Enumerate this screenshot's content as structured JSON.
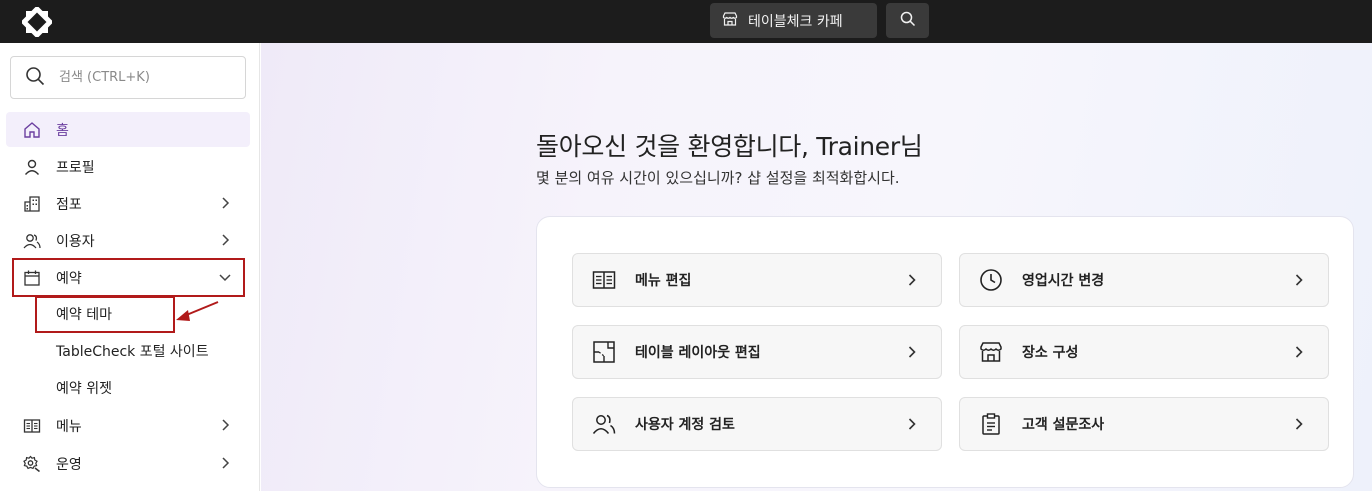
{
  "topbar": {
    "logo_icon": "tablecheck-logo-icon",
    "store_name": "테이블체크 카페",
    "store_icon": "storefront-icon",
    "search_icon": "search-icon"
  },
  "sidebar": {
    "search": {
      "placeholder": "검색 (CTRL+K)"
    },
    "items": [
      {
        "label": "홈",
        "icon": "home-icon",
        "active": true
      },
      {
        "label": "프로필",
        "icon": "person-icon"
      },
      {
        "label": "점포",
        "icon": "building-icon",
        "has_submenu": true
      },
      {
        "label": "이용자",
        "icon": "users-icon",
        "has_submenu": true
      },
      {
        "label": "예약",
        "icon": "calendar-icon",
        "expanded": true
      },
      {
        "label": "메뉴",
        "icon": "menu-book-icon",
        "has_submenu": true
      },
      {
        "label": "운영",
        "icon": "operations-gear-icon",
        "has_submenu": true
      }
    ],
    "reservation_subitems": [
      {
        "label": "예약 테마"
      },
      {
        "label": "TableCheck 포털 사이트"
      },
      {
        "label": "예약 위젯"
      }
    ]
  },
  "main": {
    "welcome": "돌아오신 것을 환영합니다, Trainer님",
    "subtitle": "몇 분의 여유 시간이 있으십니까? 샵 설정을 최적화합시다.",
    "cards": [
      {
        "label": "메뉴 편집",
        "icon": "menu-book-icon"
      },
      {
        "label": "영업시간 변경",
        "icon": "clock-icon"
      },
      {
        "label": "테이블 레이아웃 편집",
        "icon": "floor-layout-icon"
      },
      {
        "label": "장소 구성",
        "icon": "storefront-icon"
      },
      {
        "label": "사용자 계정 검토",
        "icon": "users-icon"
      },
      {
        "label": "고객 설문조사",
        "icon": "clipboard-icon"
      }
    ]
  },
  "colors": {
    "topbar_bg": "#1c1c1c",
    "active_item_bg": "#f3effb",
    "active_item_text": "#6b3fa0",
    "highlight_annotation": "#b11a1a"
  }
}
